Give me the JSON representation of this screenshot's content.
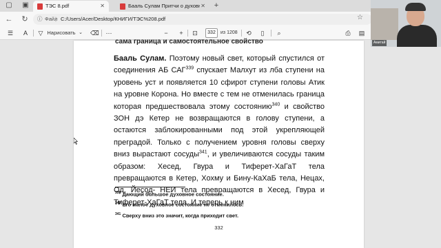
{
  "browser": {
    "tabs": [
      {
        "title": "ТЭС 8.pdf",
        "active": true
      },
      {
        "title": "Бааль Сулам Притчи о духовном",
        "active": false
      }
    ],
    "address": {
      "file_label": "Файл",
      "path": "C:/Users/Acer/Desktop/КНИГИ/ТЭС%208.pdf"
    }
  },
  "pdf_toolbar": {
    "draw_label": "Нарисовать",
    "current_page": "332",
    "total_pages": "из 1208"
  },
  "page": {
    "cut_line": "сама граница и самостоятельное свойство",
    "lead": "Бааль Сулам.",
    "body_segments": [
      " Поэтому новый свет, который спустился от соединения АБ САГ",
      "339",
      " спускает Малхут из лба ступени на уровень уст и появляется 10 сфирот ступени головы Атик на уровне Корона. Но вместе с тем не отменилась граница которая предшествовала этому состоянию",
      "340",
      " и свойство ЗОН дэ Кетер не возвращаются в голову ступени, а остаются заблокированными под этой укрепляющей преградой. Только с получением уровня головы сверху вниз вырастают сосуды",
      "341",
      ", и увеличиваются сосуды таким образом: Хесед, Гвура и Тиферет-ХаГаТ тела превращаются в Кетер, Хохму и Бину-КаХаБ тела, Нецах, Од, Йесод- НЕИ тела превращаются в Хесед, Гвура и Тиферет-ХаГаТ тела. И теперь к ним"
    ],
    "footnotes": [
      {
        "num": "339",
        "text": "Дающий большое духовное состояние."
      },
      {
        "num": "340",
        "text": "Его малое духовное состояние не отменилось."
      },
      {
        "num": "341",
        "text": "Сверху вниз это значит, когда приходит свет."
      }
    ],
    "page_number": "332"
  },
  "webcam": {
    "name_tag": "Амитай"
  },
  "colors": {
    "pdf_red": "#d83b3b",
    "toolbar_bg": "#f7f7f7",
    "viewer_bg": "#e6e6e6"
  }
}
